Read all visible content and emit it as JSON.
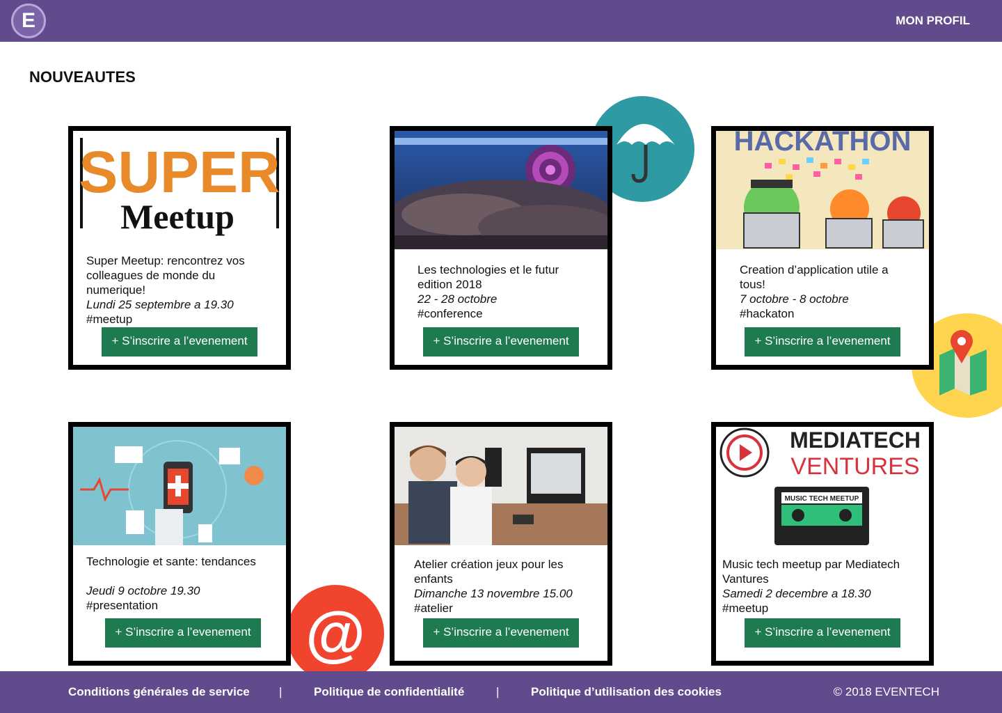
{
  "header": {
    "logo_letter": "E",
    "profile_label": "MON PROFIL"
  },
  "main": {
    "title": "NOUVEAUTES"
  },
  "events": [
    {
      "thumb_text_1": "SUPER",
      "thumb_text_2": "Meetup",
      "title": "Super Meetup: rencontrez vos colleagues de monde du numerique!",
      "date": "Lundi 25 septembre a 19.30",
      "tag": "#meetup",
      "button": "+ S’inscrire a l’evenement"
    },
    {
      "title": "Les technologies et le futur edition 2018",
      "date": "22 - 28 octobre",
      "tag": "#conference",
      "button": "+ S’inscrire a l’evenement"
    },
    {
      "thumb_text": "HACKATHON",
      "title": "Creation d’application utile a tous!",
      "date": "7 octobre - 8 octobre",
      "tag": "#hackaton",
      "button": "+ S’inscrire a l’evenement"
    },
    {
      "title": "Technologie et sante: tendances",
      "date": "Jeudi 9 octobre 19.30",
      "tag": "#presentation",
      "button": "+ S’inscrire a l’evenement"
    },
    {
      "title": "Atelier création jeux pour les enfants",
      "date": "Dimanche 13 novembre 15.00",
      "tag": "#atelier",
      "button": "+ S’inscrire a l’evenement"
    },
    {
      "thumb_text_1": "MEDIATECH",
      "thumb_text_2": "VENTURES",
      "thumb_text_3": "MUSIC TECH MEETUP",
      "title": "Music tech meetup par Mediatech Vantures",
      "date": "Samedi 2 decembre a 18.30",
      "tag": "#meetup",
      "button": "+ S’inscrire a l’evenement"
    }
  ],
  "decorations": [
    {
      "icon": "umbrella-icon",
      "color": "#2E9AA4"
    },
    {
      "icon": "map-pin-icon",
      "color": "#FFD54F"
    },
    {
      "icon": "at-sign-icon",
      "color": "#F0442F",
      "glyph": "@"
    }
  ],
  "footer": {
    "links": [
      "Conditions générales de service",
      "Politique de confidentialité",
      "Politique d’utilisation des cookies"
    ],
    "separator": "|",
    "copyright": "© 2018 EVENTECH"
  },
  "colors": {
    "brand": "#614B8C",
    "button": "#1E7B4F",
    "border": "#000000"
  }
}
